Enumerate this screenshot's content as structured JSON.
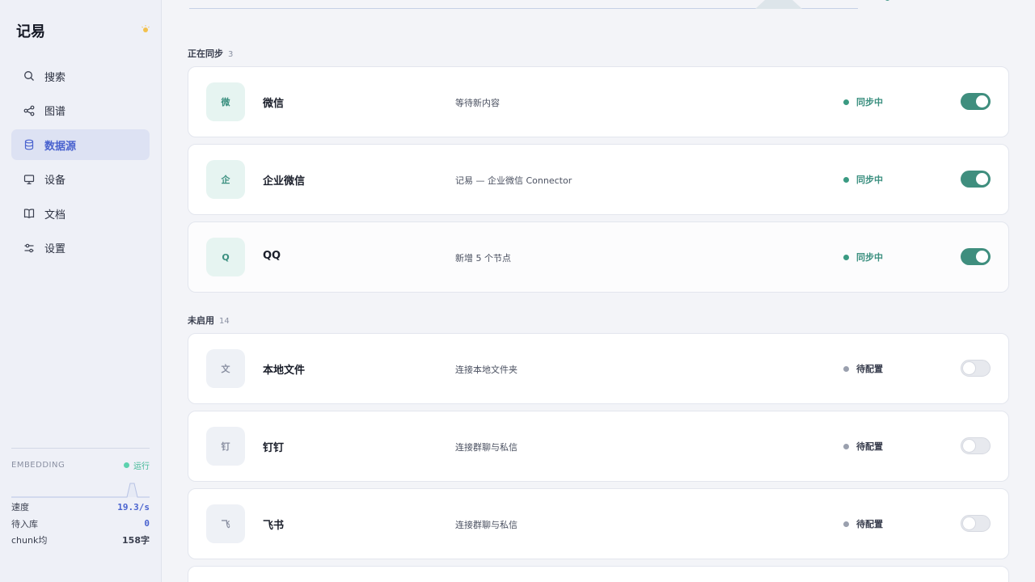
{
  "app": {
    "title": "记易"
  },
  "sidebar": {
    "items": [
      {
        "label": "搜索",
        "icon": "search-icon"
      },
      {
        "label": "图谱",
        "icon": "share-graph-icon"
      },
      {
        "label": "数据源",
        "icon": "database-icon",
        "active": true
      },
      {
        "label": "设备",
        "icon": "monitor-icon"
      },
      {
        "label": "文档",
        "icon": "book-icon"
      },
      {
        "label": "设置",
        "icon": "sliders-icon"
      }
    ],
    "embedding": {
      "label": "EMBEDDING",
      "status": "运行",
      "stats": [
        {
          "label": "速度",
          "value": "19.3/s"
        },
        {
          "label": "待入库",
          "value": "0"
        },
        {
          "label": "chunk均",
          "value": "158字"
        }
      ]
    }
  },
  "sections": [
    {
      "title": "正在同步",
      "count": "3",
      "cards": [
        {
          "logo": "微",
          "name": "微信",
          "desc": "等待新内容",
          "status": "同步中",
          "enabled": true
        },
        {
          "logo": "企",
          "name": "企业微信",
          "desc": "记易 — 企业微信 Connector",
          "status": "同步中",
          "enabled": true
        },
        {
          "logo": "Q",
          "name": "QQ",
          "desc": "新增 5 个节点",
          "status": "同步中",
          "enabled": true
        }
      ]
    },
    {
      "title": "未启用",
      "count": "14",
      "cards": [
        {
          "logo": "文",
          "name": "本地文件",
          "desc": "连接本地文件夹",
          "status": "待配置",
          "enabled": false
        },
        {
          "logo": "钉",
          "name": "钉钉",
          "desc": "连接群聊与私信",
          "status": "待配置",
          "enabled": false
        },
        {
          "logo": "飞",
          "name": "飞书",
          "desc": "连接群聊与私信",
          "status": "待配置",
          "enabled": false
        }
      ]
    }
  ],
  "colors": {
    "accent": "#4a63cf",
    "sync": "#3f8e7e",
    "muted": "#9aa0ae"
  }
}
